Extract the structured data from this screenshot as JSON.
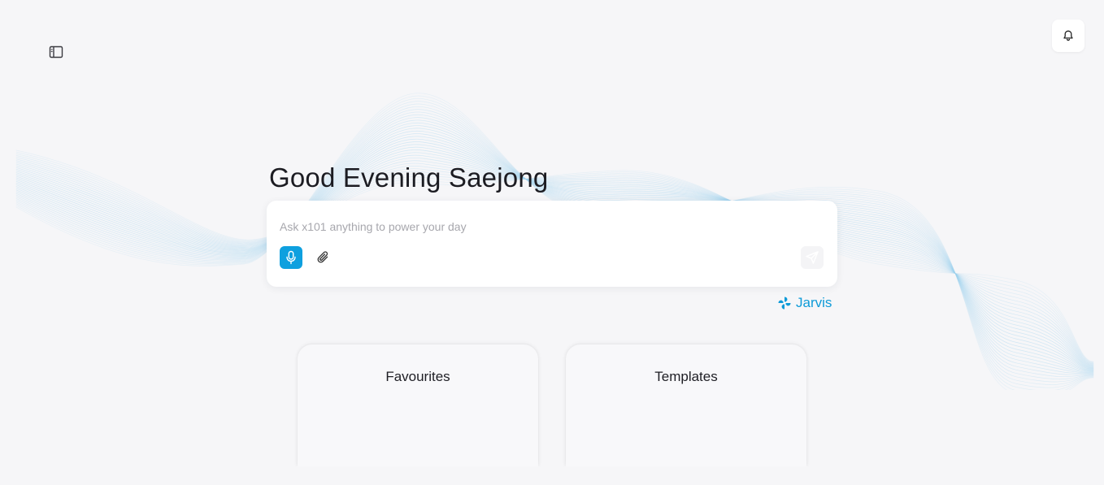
{
  "header": {
    "sidebar_toggle_icon": "sidebar-toggle-icon",
    "notifications_icon": "bell-icon"
  },
  "greeting": "Good Evening Saejong",
  "prompt": {
    "placeholder": "Ask x101 anything to power your day",
    "value": "",
    "mic_icon": "microphone-icon",
    "attach_icon": "paperclip-icon",
    "send_icon": "send-icon"
  },
  "agent": {
    "label": "Jarvis",
    "icon": "pinwheel-icon"
  },
  "panels": [
    {
      "title": "Favourites"
    },
    {
      "title": "Templates"
    }
  ],
  "colors": {
    "accent": "#0ea0df",
    "background": "#f6f6f8",
    "card": "#ffffff",
    "wave": "#9fd3ef"
  }
}
